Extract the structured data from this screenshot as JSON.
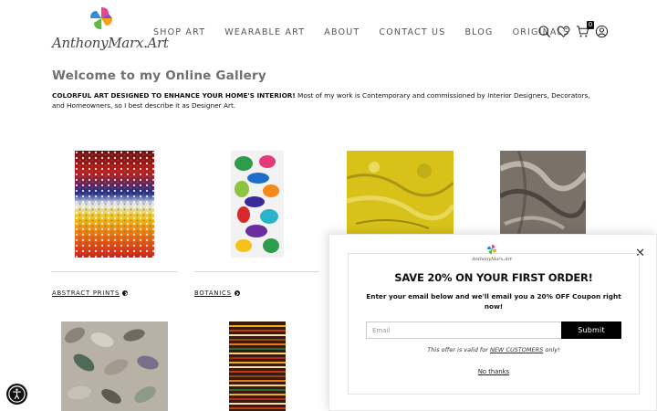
{
  "header": {
    "logo_text": "AnthonyMarx.Art",
    "nav": [
      "SHOP ART",
      "WEARABLE ART",
      "ABOUT",
      "CONTACT US",
      "BLOG",
      "ORIGINALS"
    ],
    "icons": [
      "search-icon",
      "heart-icon",
      "cart-icon",
      "account-icon"
    ],
    "cart_count": "0"
  },
  "main": {
    "title": "Welcome to my Online Gallery",
    "intro_bold": "COLORFUL ART DESIGNED TO ENHANCE YOUR HOME'S INTERIOR!",
    "intro_rest": " Most of my work is Contemporary and commissioned by Interior Designers, Decorators, and Homeowners, so I best describe it as Designer Art."
  },
  "products": [
    {
      "category": "ABSTRACT PRINTS",
      "image": "colorful dotted gradient painting"
    },
    {
      "category": "BOTANICS",
      "image": "colorful botanical painting"
    },
    {
      "category": "",
      "image": "yellow fluid painting"
    },
    {
      "category": "",
      "image": "grey marble painting"
    },
    {
      "category": "",
      "image": "grey leaf mosaic painting"
    },
    {
      "category": "",
      "image": "brown striped painting"
    }
  ],
  "popup": {
    "logo_text": "AnthonyMarx.Art",
    "title": "SAVE 20% ON YOUR FIRST ORDER!",
    "description": "Enter your email below and we'll email you a 20% OFF Coupon right now!",
    "email_placeholder": "Email",
    "submit_label": "Submit",
    "note_prefix": "This offer is valid for ",
    "note_link": "NEW CUSTOMERS",
    "note_suffix": " only!",
    "dismiss_label": "No thanks",
    "close_icon": "close-icon"
  },
  "accessibility": {
    "icon": "accessibility-icon"
  }
}
